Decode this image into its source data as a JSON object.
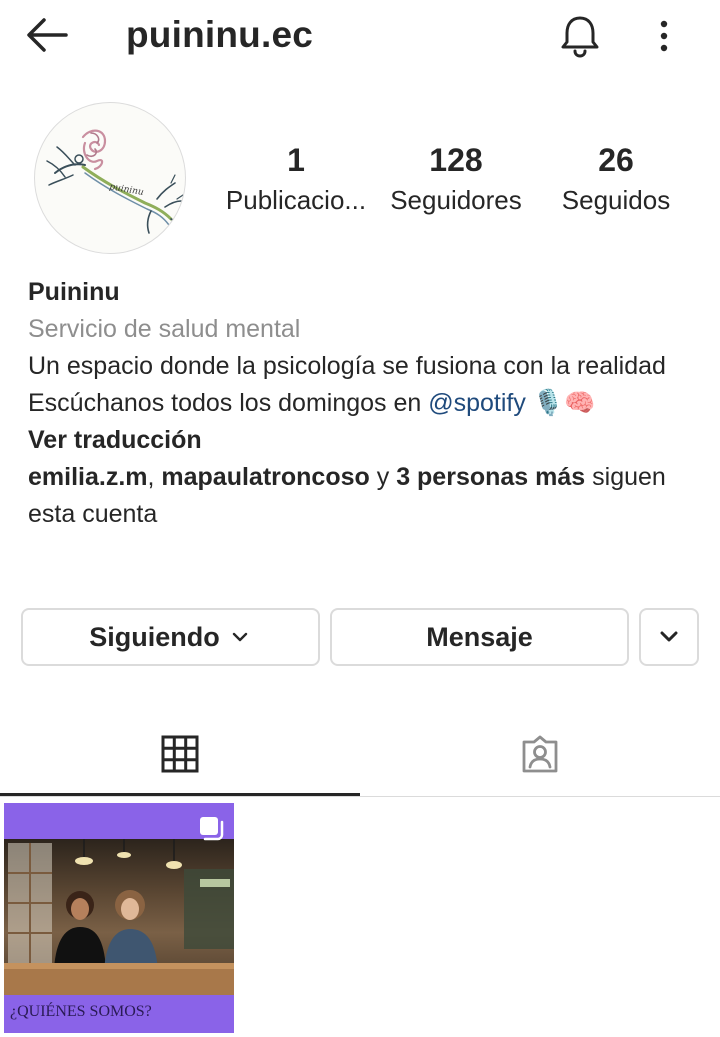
{
  "header": {
    "username": "puininu.ec"
  },
  "profile": {
    "stats": [
      {
        "value": "1",
        "label": "Publicacio..."
      },
      {
        "value": "128",
        "label": "Seguidores"
      },
      {
        "value": "26",
        "label": "Seguidos"
      }
    ],
    "name": "Puininu",
    "category": "Servicio de salud mental",
    "bio_line1": "Un espacio donde la psicología se fusiona con la realidad",
    "bio_line2_prefix": "Escúchanos todos los domingos en ",
    "bio_mention": "@spotify",
    "bio_emoji": "🎙️🧠",
    "translate_label": "Ver traducción",
    "followed_by": {
      "user1": "emilia.z.m",
      "comma": ", ",
      "user2": "mapaulatroncoso",
      "connector": " y ",
      "others": "3 personas más",
      "suffix": " siguen esta cuenta"
    }
  },
  "actions": {
    "following_label": "Siguiendo",
    "message_label": "Mensaje"
  },
  "posts": [
    {
      "caption": "¿QUIÉNES SOMOS?"
    }
  ],
  "colors": {
    "text": "#262626",
    "secondary": "#8e8e8e",
    "link": "#1f4a7c",
    "border": "#dbdbdb",
    "post_bg": "#8a63e8"
  }
}
